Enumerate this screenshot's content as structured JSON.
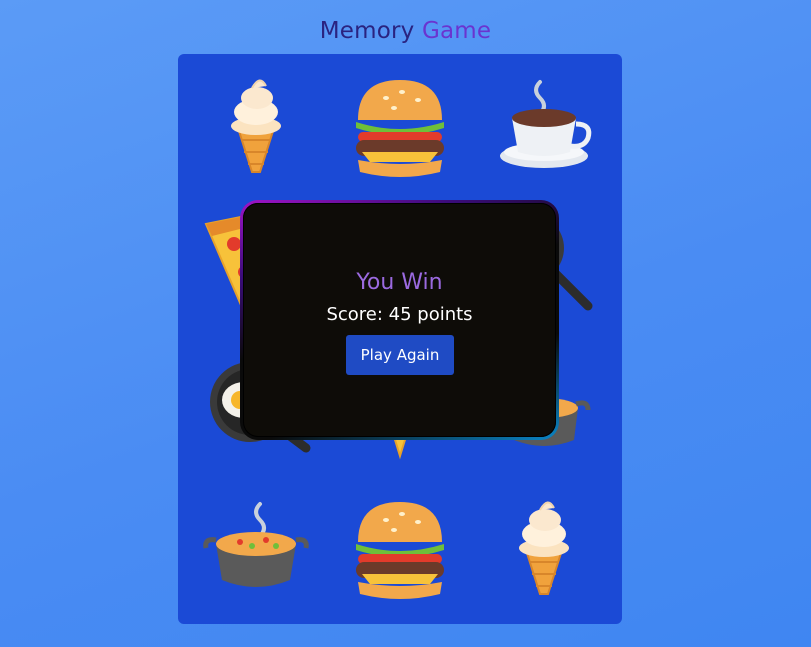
{
  "header": {
    "title_part1": "Memory",
    "title_part2": "Game"
  },
  "board": {
    "cards": [
      {
        "icon": "ice-cream-icon"
      },
      {
        "icon": "burger-icon"
      },
      {
        "icon": "coffee-cup-icon"
      },
      {
        "icon": "pizza-icon"
      },
      {
        "icon": "hidden"
      },
      {
        "icon": "frying-pan-icon"
      },
      {
        "icon": "fried-egg-pan-icon"
      },
      {
        "icon": "pizza-icon"
      },
      {
        "icon": "stew-pot-icon"
      },
      {
        "icon": "stew-pot-icon"
      },
      {
        "icon": "burger-icon"
      },
      {
        "icon": "ice-cream-icon"
      }
    ]
  },
  "modal": {
    "title": "You Win",
    "score_text": "Score: 45 points",
    "button_label": "Play Again"
  },
  "colors": {
    "background": "#4a8cf3",
    "board": "#1b4ad6",
    "modal": "#0e0c08",
    "button": "#1f4bc4",
    "win_text": "#9b6ae0"
  }
}
